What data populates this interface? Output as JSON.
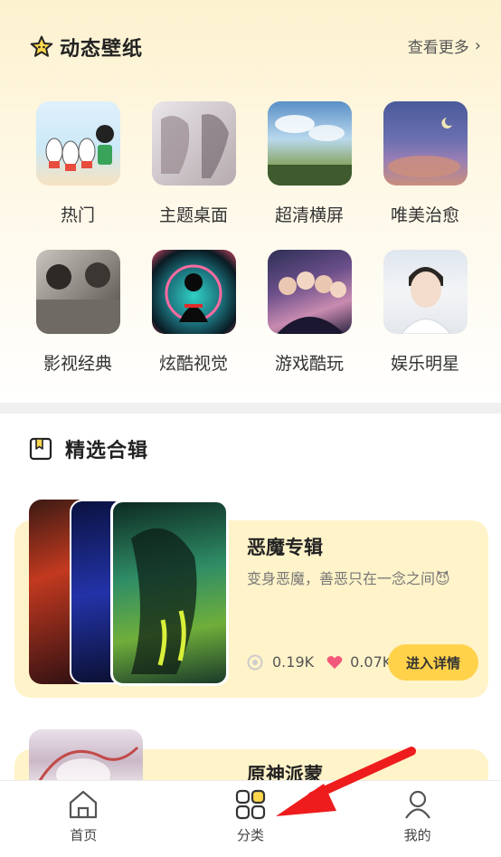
{
  "dynamic_section": {
    "title": "动态壁纸",
    "more_label": "查看更多",
    "icon": "star-icon",
    "categories": [
      {
        "label": "热门"
      },
      {
        "label": "主题桌面"
      },
      {
        "label": "超清横屏"
      },
      {
        "label": "唯美治愈"
      },
      {
        "label": "影视经典"
      },
      {
        "label": "炫酷视觉"
      },
      {
        "label": "游戏酷玩"
      },
      {
        "label": "娱乐明星"
      }
    ]
  },
  "collection_section": {
    "title": "精选合辑",
    "icon": "bookmark-icon",
    "cards": [
      {
        "title": "恶魔专辑",
        "description": "变身恶魔，善恶只在一念之间",
        "emoji": "😈",
        "views": "0.19K",
        "likes": "0.07K",
        "button_label": "进入详情"
      },
      {
        "title": "原神派蒙"
      }
    ]
  },
  "tabbar": {
    "items": [
      {
        "label": "首页",
        "icon": "home-icon"
      },
      {
        "label": "分类",
        "icon": "category-grid-icon",
        "active": true
      },
      {
        "label": "我的",
        "icon": "user-icon"
      }
    ]
  },
  "colors": {
    "accent": "#ffd24a",
    "card_bg": "#fff3c9",
    "annotation_arrow": "#ee1c1c"
  }
}
